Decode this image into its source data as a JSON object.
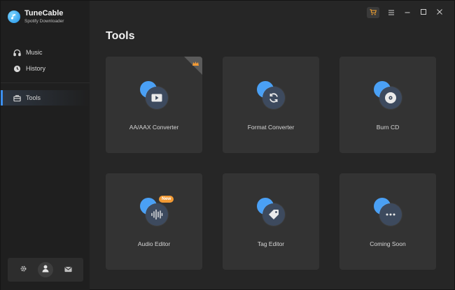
{
  "app": {
    "name": "TuneCable",
    "subtitle": "Spotify Downloader"
  },
  "sidebar": {
    "items": [
      {
        "label": "Music",
        "icon": "headphones-icon"
      },
      {
        "label": "History",
        "icon": "clock-icon"
      },
      {
        "label": "Tools",
        "icon": "toolbox-icon",
        "active": true
      }
    ]
  },
  "main": {
    "title": "Tools",
    "cards": [
      {
        "label": "AA/AAX Converter",
        "icon": "play-icon",
        "premium": true
      },
      {
        "label": "Format Converter",
        "icon": "refresh-icon"
      },
      {
        "label": "Burn CD",
        "icon": "disc-icon"
      },
      {
        "label": "Audio Editor",
        "icon": "waveform-icon",
        "badge": "New"
      },
      {
        "label": "Tag Editor",
        "icon": "tag-icon"
      },
      {
        "label": "Coming Soon",
        "icon": "more-icon"
      }
    ]
  },
  "colors": {
    "accent": "#3b8ff0",
    "bubble": "#4aa0f5",
    "badge": "#f29a34"
  }
}
